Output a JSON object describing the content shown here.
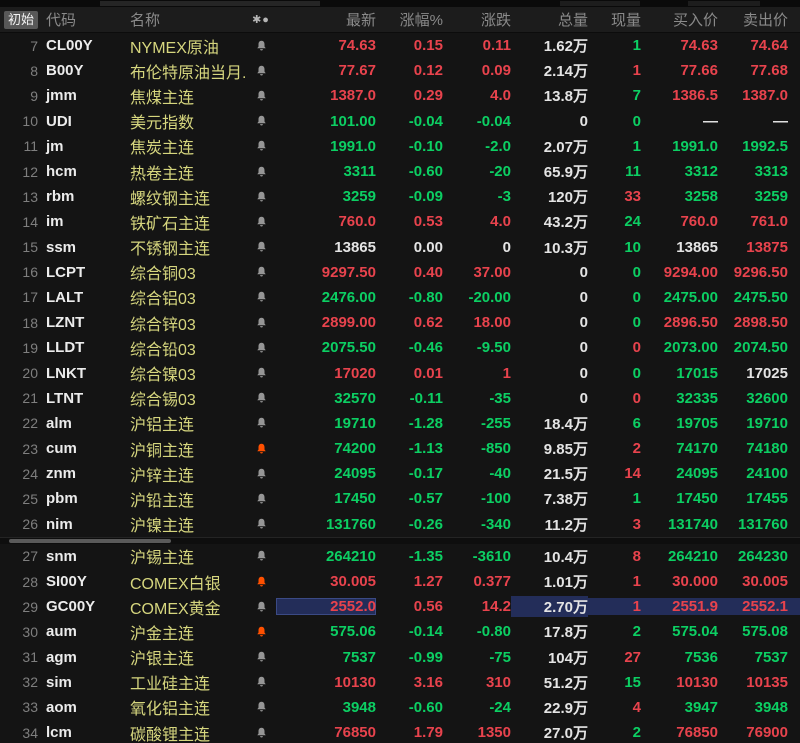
{
  "header": {
    "initial": "初始",
    "code": "代码",
    "name": "名称",
    "icon_asterisk": "✱",
    "icon_dot": "●",
    "latest": "最新",
    "pct": "涨幅%",
    "chg": "涨跌",
    "vol": "总量",
    "cur": "现量",
    "buy": "买入价",
    "sell": "卖出价"
  },
  "colors": {
    "up_red": "#e8434d",
    "down_green": "#0ccf63",
    "neutral_white": "#e4e4e4",
    "name_yellow": "#d6d67e",
    "selection_blue": "#232d59",
    "alert_orange": "#ff5000"
  },
  "rows": [
    {
      "num": "7",
      "code": "CL00Y",
      "name": "NYMEX原油",
      "bell": "gray",
      "selected": false,
      "cells": [
        [
          "74.63",
          "r"
        ],
        [
          "0.15",
          "r"
        ],
        [
          "0.11",
          "r"
        ],
        [
          "1.62万",
          "w"
        ],
        [
          "1",
          "g"
        ],
        [
          "74.63",
          "r"
        ],
        [
          "74.64",
          "r"
        ]
      ]
    },
    {
      "num": "8",
      "code": "B00Y",
      "name": "布伦特原油当月...",
      "bell": "gray",
      "selected": false,
      "cells": [
        [
          "77.67",
          "r"
        ],
        [
          "0.12",
          "r"
        ],
        [
          "0.09",
          "r"
        ],
        [
          "2.14万",
          "w"
        ],
        [
          "1",
          "r"
        ],
        [
          "77.66",
          "r"
        ],
        [
          "77.68",
          "r"
        ]
      ]
    },
    {
      "num": "9",
      "code": "jmm",
      "name": "焦煤主连",
      "bell": "gray",
      "selected": false,
      "cells": [
        [
          "1387.0",
          "r"
        ],
        [
          "0.29",
          "r"
        ],
        [
          "4.0",
          "r"
        ],
        [
          "13.8万",
          "w"
        ],
        [
          "7",
          "g"
        ],
        [
          "1386.5",
          "r"
        ],
        [
          "1387.0",
          "r"
        ]
      ]
    },
    {
      "num": "10",
      "code": "UDI",
      "name": "美元指数",
      "bell": "gray",
      "selected": false,
      "cells": [
        [
          "101.00",
          "g"
        ],
        [
          "-0.04",
          "g"
        ],
        [
          "-0.04",
          "g"
        ],
        [
          "0",
          "w"
        ],
        [
          "0",
          "g"
        ],
        [
          "—",
          "w"
        ],
        [
          "—",
          "w"
        ]
      ]
    },
    {
      "num": "11",
      "code": "jm",
      "name": "焦炭主连",
      "bell": "gray",
      "selected": false,
      "cells": [
        [
          "1991.0",
          "g"
        ],
        [
          "-0.10",
          "g"
        ],
        [
          "-2.0",
          "g"
        ],
        [
          "2.07万",
          "w"
        ],
        [
          "1",
          "g"
        ],
        [
          "1991.0",
          "g"
        ],
        [
          "1992.5",
          "g"
        ]
      ]
    },
    {
      "num": "12",
      "code": "hcm",
      "name": "热卷主连",
      "bell": "gray",
      "selected": false,
      "cells": [
        [
          "3311",
          "g"
        ],
        [
          "-0.60",
          "g"
        ],
        [
          "-20",
          "g"
        ],
        [
          "65.9万",
          "w"
        ],
        [
          "11",
          "g"
        ],
        [
          "3312",
          "g"
        ],
        [
          "3313",
          "g"
        ]
      ]
    },
    {
      "num": "13",
      "code": "rbm",
      "name": "螺纹钢主连",
      "bell": "gray",
      "selected": false,
      "cells": [
        [
          "3259",
          "g"
        ],
        [
          "-0.09",
          "g"
        ],
        [
          "-3",
          "g"
        ],
        [
          "120万",
          "w"
        ],
        [
          "33",
          "r"
        ],
        [
          "3258",
          "g"
        ],
        [
          "3259",
          "g"
        ]
      ]
    },
    {
      "num": "14",
      "code": "im",
      "name": "铁矿石主连",
      "bell": "gray",
      "selected": false,
      "cells": [
        [
          "760.0",
          "r"
        ],
        [
          "0.53",
          "r"
        ],
        [
          "4.0",
          "r"
        ],
        [
          "43.2万",
          "w"
        ],
        [
          "24",
          "g"
        ],
        [
          "760.0",
          "r"
        ],
        [
          "761.0",
          "r"
        ]
      ]
    },
    {
      "num": "15",
      "code": "ssm",
      "name": "不锈钢主连",
      "bell": "gray",
      "selected": false,
      "cells": [
        [
          "13865",
          "w"
        ],
        [
          "0.00",
          "w"
        ],
        [
          "0",
          "w"
        ],
        [
          "10.3万",
          "w"
        ],
        [
          "10",
          "g"
        ],
        [
          "13865",
          "w"
        ],
        [
          "13875",
          "r"
        ]
      ]
    },
    {
      "num": "16",
      "code": "LCPT",
      "name": "综合铜03",
      "bell": "gray",
      "selected": false,
      "cells": [
        [
          "9297.50",
          "r"
        ],
        [
          "0.40",
          "r"
        ],
        [
          "37.00",
          "r"
        ],
        [
          "0",
          "w"
        ],
        [
          "0",
          "g"
        ],
        [
          "9294.00",
          "r"
        ],
        [
          "9296.50",
          "r"
        ]
      ]
    },
    {
      "num": "17",
      "code": "LALT",
      "name": "综合铝03",
      "bell": "gray",
      "selected": false,
      "cells": [
        [
          "2476.00",
          "g"
        ],
        [
          "-0.80",
          "g"
        ],
        [
          "-20.00",
          "g"
        ],
        [
          "0",
          "w"
        ],
        [
          "0",
          "g"
        ],
        [
          "2475.00",
          "g"
        ],
        [
          "2475.50",
          "g"
        ]
      ]
    },
    {
      "num": "18",
      "code": "LZNT",
      "name": "综合锌03",
      "bell": "gray",
      "selected": false,
      "cells": [
        [
          "2899.00",
          "r"
        ],
        [
          "0.62",
          "r"
        ],
        [
          "18.00",
          "r"
        ],
        [
          "0",
          "w"
        ],
        [
          "0",
          "g"
        ],
        [
          "2896.50",
          "r"
        ],
        [
          "2898.50",
          "r"
        ]
      ]
    },
    {
      "num": "19",
      "code": "LLDT",
      "name": "综合铅03",
      "bell": "gray",
      "selected": false,
      "cells": [
        [
          "2075.50",
          "g"
        ],
        [
          "-0.46",
          "g"
        ],
        [
          "-9.50",
          "g"
        ],
        [
          "0",
          "w"
        ],
        [
          "0",
          "r"
        ],
        [
          "2073.00",
          "g"
        ],
        [
          "2074.50",
          "g"
        ]
      ]
    },
    {
      "num": "20",
      "code": "LNKT",
      "name": "综合镍03",
      "bell": "gray",
      "selected": false,
      "cells": [
        [
          "17020",
          "r"
        ],
        [
          "0.01",
          "r"
        ],
        [
          "1",
          "r"
        ],
        [
          "0",
          "w"
        ],
        [
          "0",
          "g"
        ],
        [
          "17015",
          "g"
        ],
        [
          "17025",
          "w"
        ]
      ]
    },
    {
      "num": "21",
      "code": "LTNT",
      "name": "综合锡03",
      "bell": "gray",
      "selected": false,
      "cells": [
        [
          "32570",
          "g"
        ],
        [
          "-0.11",
          "g"
        ],
        [
          "-35",
          "g"
        ],
        [
          "0",
          "w"
        ],
        [
          "0",
          "r"
        ],
        [
          "32335",
          "g"
        ],
        [
          "32600",
          "g"
        ]
      ]
    },
    {
      "num": "22",
      "code": "alm",
      "name": "沪铝主连",
      "bell": "gray",
      "selected": false,
      "cells": [
        [
          "19710",
          "g"
        ],
        [
          "-1.28",
          "g"
        ],
        [
          "-255",
          "g"
        ],
        [
          "18.4万",
          "w"
        ],
        [
          "6",
          "g"
        ],
        [
          "19705",
          "g"
        ],
        [
          "19710",
          "g"
        ]
      ]
    },
    {
      "num": "23",
      "code": "cum",
      "name": "沪铜主连",
      "bell": "orange",
      "selected": false,
      "cells": [
        [
          "74200",
          "g"
        ],
        [
          "-1.13",
          "g"
        ],
        [
          "-850",
          "g"
        ],
        [
          "9.85万",
          "w"
        ],
        [
          "2",
          "r"
        ],
        [
          "74170",
          "g"
        ],
        [
          "74180",
          "g"
        ]
      ]
    },
    {
      "num": "24",
      "code": "znm",
      "name": "沪锌主连",
      "bell": "gray",
      "selected": false,
      "cells": [
        [
          "24095",
          "g"
        ],
        [
          "-0.17",
          "g"
        ],
        [
          "-40",
          "g"
        ],
        [
          "21.5万",
          "w"
        ],
        [
          "14",
          "r"
        ],
        [
          "24095",
          "g"
        ],
        [
          "24100",
          "g"
        ]
      ]
    },
    {
      "num": "25",
      "code": "pbm",
      "name": "沪铅主连",
      "bell": "gray",
      "selected": false,
      "cells": [
        [
          "17450",
          "g"
        ],
        [
          "-0.57",
          "g"
        ],
        [
          "-100",
          "g"
        ],
        [
          "7.38万",
          "w"
        ],
        [
          "1",
          "g"
        ],
        [
          "17450",
          "g"
        ],
        [
          "17455",
          "g"
        ]
      ]
    },
    {
      "num": "26",
      "code": "nim",
      "name": "沪镍主连",
      "bell": "gray",
      "selected": false,
      "cells": [
        [
          "131760",
          "g"
        ],
        [
          "-0.26",
          "g"
        ],
        [
          "-340",
          "g"
        ],
        [
          "11.2万",
          "w"
        ],
        [
          "3",
          "r"
        ],
        [
          "131740",
          "g"
        ],
        [
          "131760",
          "g"
        ]
      ]
    },
    {
      "num": "27",
      "code": "snm",
      "name": "沪锡主连",
      "bell": "gray",
      "selected": false,
      "cells": [
        [
          "264210",
          "g"
        ],
        [
          "-1.35",
          "g"
        ],
        [
          "-3610",
          "g"
        ],
        [
          "10.4万",
          "w"
        ],
        [
          "8",
          "r"
        ],
        [
          "264210",
          "g"
        ],
        [
          "264230",
          "g"
        ]
      ]
    },
    {
      "num": "28",
      "code": "SI00Y",
      "name": "COMEX白银",
      "bell": "orange",
      "selected": false,
      "cells": [
        [
          "30.005",
          "r"
        ],
        [
          "1.27",
          "r"
        ],
        [
          "0.377",
          "r"
        ],
        [
          "1.01万",
          "w"
        ],
        [
          "1",
          "r"
        ],
        [
          "30.000",
          "r"
        ],
        [
          "30.005",
          "r"
        ]
      ]
    },
    {
      "num": "29",
      "code": "GC00Y",
      "name": "COMEX黄金",
      "bell": "gray",
      "selected": true,
      "cells": [
        [
          "2552.0",
          "r"
        ],
        [
          "0.56",
          "r"
        ],
        [
          "14.2",
          "r"
        ],
        [
          "2.70万",
          "w"
        ],
        [
          "1",
          "r"
        ],
        [
          "2551.9",
          "r"
        ],
        [
          "2552.1",
          "r"
        ]
      ]
    },
    {
      "num": "30",
      "code": "aum",
      "name": "沪金主连",
      "bell": "orange",
      "selected": false,
      "cells": [
        [
          "575.06",
          "g"
        ],
        [
          "-0.14",
          "g"
        ],
        [
          "-0.80",
          "g"
        ],
        [
          "17.8万",
          "w"
        ],
        [
          "2",
          "g"
        ],
        [
          "575.04",
          "g"
        ],
        [
          "575.08",
          "g"
        ]
      ]
    },
    {
      "num": "31",
      "code": "agm",
      "name": "沪银主连",
      "bell": "gray",
      "selected": false,
      "cells": [
        [
          "7537",
          "g"
        ],
        [
          "-0.99",
          "g"
        ],
        [
          "-75",
          "g"
        ],
        [
          "104万",
          "w"
        ],
        [
          "27",
          "r"
        ],
        [
          "7536",
          "g"
        ],
        [
          "7537",
          "g"
        ]
      ]
    },
    {
      "num": "32",
      "code": "sim",
      "name": "工业硅主连",
      "bell": "gray",
      "selected": false,
      "cells": [
        [
          "10130",
          "r"
        ],
        [
          "3.16",
          "r"
        ],
        [
          "310",
          "r"
        ],
        [
          "51.2万",
          "w"
        ],
        [
          "15",
          "g"
        ],
        [
          "10130",
          "r"
        ],
        [
          "10135",
          "r"
        ]
      ]
    },
    {
      "num": "33",
      "code": "aom",
      "name": "氧化铝主连",
      "bell": "gray",
      "selected": false,
      "cells": [
        [
          "3948",
          "g"
        ],
        [
          "-0.60",
          "g"
        ],
        [
          "-24",
          "g"
        ],
        [
          "22.9万",
          "w"
        ],
        [
          "4",
          "r"
        ],
        [
          "3947",
          "g"
        ],
        [
          "3948",
          "g"
        ]
      ]
    },
    {
      "num": "34",
      "code": "lcm",
      "name": "碳酸锂主连",
      "bell": "gray",
      "selected": false,
      "cells": [
        [
          "76850",
          "r"
        ],
        [
          "1.79",
          "r"
        ],
        [
          "1350",
          "r"
        ],
        [
          "27.0万",
          "w"
        ],
        [
          "2",
          "g"
        ],
        [
          "76850",
          "r"
        ],
        [
          "76900",
          "r"
        ]
      ]
    }
  ],
  "panes": {
    "top_pane_rows": 20,
    "bottom_pane_rows": 8
  }
}
